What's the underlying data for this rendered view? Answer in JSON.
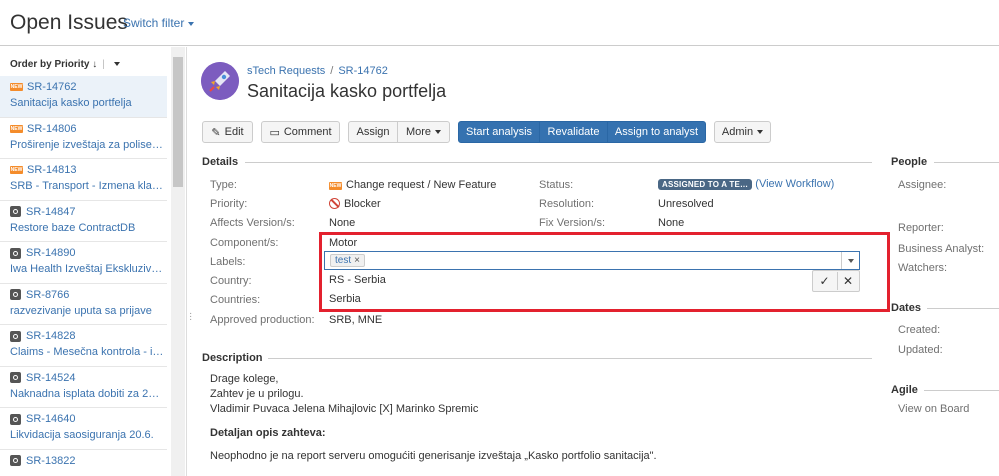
{
  "header": {
    "title": "Open Issues",
    "switch_filter": "Switch filter"
  },
  "list": {
    "order_by": "Order by Priority",
    "items": [
      {
        "key": "SR-14762",
        "summary": "Sanitacija kasko portfelja",
        "type": "new",
        "selected": true
      },
      {
        "key": "SR-14806",
        "summary": "Proširenje izveštaja za polise …",
        "type": "new"
      },
      {
        "key": "SR-14813",
        "summary": "SRB - Transport - Izmena kla…",
        "type": "new"
      },
      {
        "key": "SR-14847",
        "summary": "Restore baze ContractDB",
        "type": "task"
      },
      {
        "key": "SR-14890",
        "summary": "Iwa Health Izveštaj Ekskluziv…",
        "type": "task"
      },
      {
        "key": "SR-8766",
        "summary": "razvezivanje uputa sa prijave",
        "type": "task"
      },
      {
        "key": "SR-14828",
        "summary": "Claims - Mesečna kontrola - i…",
        "type": "task"
      },
      {
        "key": "SR-14524",
        "summary": "Naknadna isplata dobiti za 20…",
        "type": "task"
      },
      {
        "key": "SR-14640",
        "summary": "Likvidacija saosiguranja 20.6.",
        "type": "task"
      },
      {
        "key": "SR-13822",
        "summary": "",
        "type": "task"
      }
    ]
  },
  "issue": {
    "project": "sTech Requests",
    "key": "SR-14762",
    "title": "Sanitacija kasko portfelja"
  },
  "toolbar": {
    "edit": "Edit",
    "comment": "Comment",
    "assign": "Assign",
    "more": "More",
    "start_analysis": "Start analysis",
    "revalidate": "Revalidate",
    "assign_to_analyst": "Assign to analyst",
    "admin": "Admin"
  },
  "details": {
    "section": "Details",
    "type_label": "Type:",
    "type_value": "Change request / New Feature",
    "status_label": "Status:",
    "status_value": "ASSIGNED TO A TE…",
    "view_workflow": "(View Workflow)",
    "priority_label": "Priority:",
    "priority_value": "Blocker",
    "resolution_label": "Resolution:",
    "resolution_value": "Unresolved",
    "affects_label": "Affects Version/s:",
    "affects_value": "None",
    "fix_label": "Fix Version/s:",
    "fix_value": "None",
    "component_label": "Component/s:",
    "component_value": "Motor",
    "labels_label": "Labels:",
    "label_chip": "test",
    "country_label": "Country:",
    "countries_label": "Countries:",
    "approved_label": "Approved production:",
    "approved_value": "SRB, MNE",
    "suggestions": [
      "RS - Serbia",
      "Serbia"
    ]
  },
  "description": {
    "section": "Description",
    "line1": "Drage kolege,",
    "line2": "Zahtev je u prilogu.",
    "mentions": "Vladimir Puvaca Jelena Mihajlovic [X] Marinko Spremic",
    "detail_heading": "Detaljan opis zahteva:",
    "detail_text": "Neophodno je na report serveru omogućiti generisanje izveštaja „Kasko portfolio sanitacija\"."
  },
  "people": {
    "section": "People",
    "assignee": "Assignee:",
    "reporter": "Reporter:",
    "business_analyst": "Business Analyst:",
    "watchers": "Watchers:"
  },
  "dates": {
    "section": "Dates",
    "created": "Created:",
    "updated": "Updated:"
  },
  "agile": {
    "section": "Agile",
    "view_on_board": "View on Board"
  }
}
